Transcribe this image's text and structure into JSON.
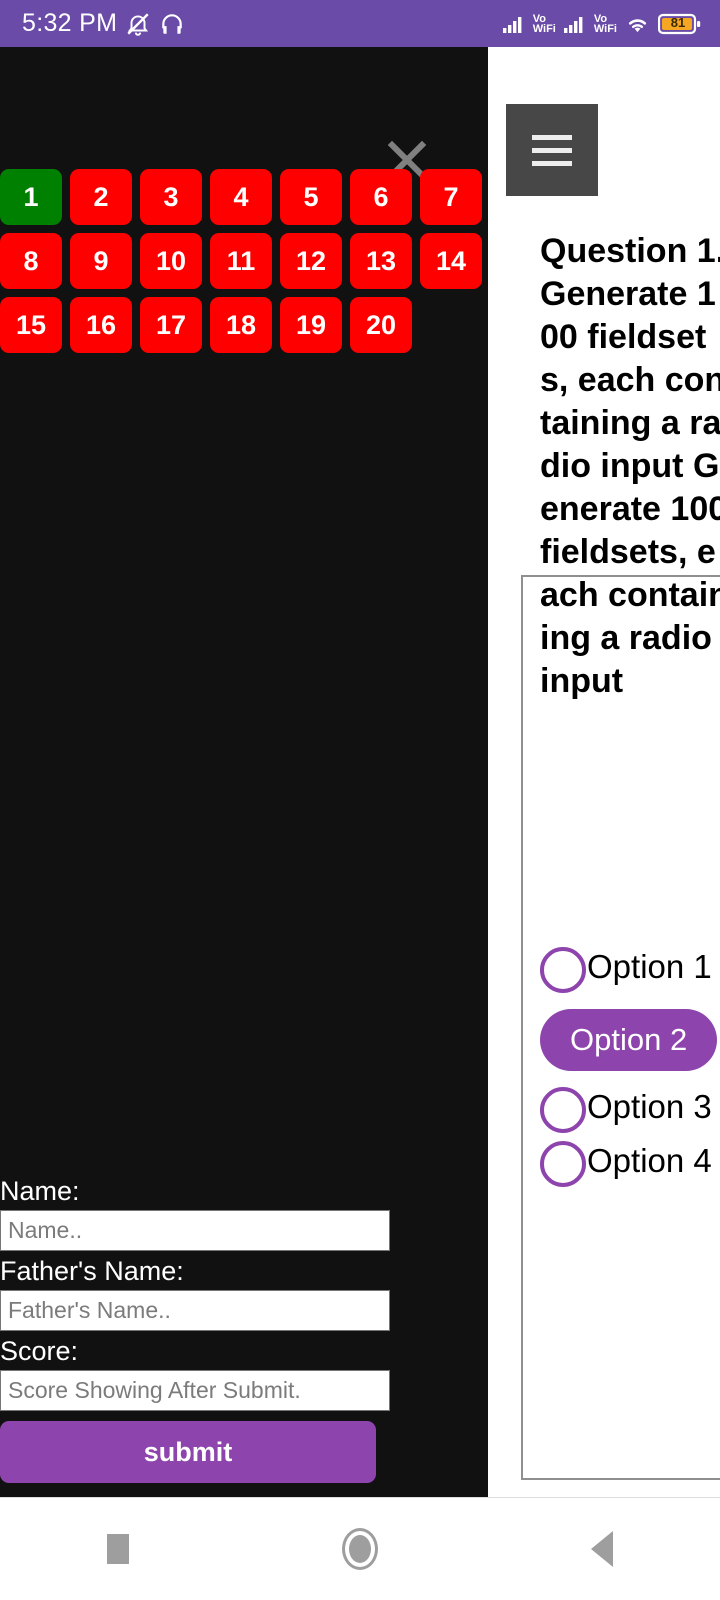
{
  "statusbar": {
    "time": "5:32 PM",
    "icons_left": [
      "bell-muted-icon",
      "headphones-icon"
    ],
    "network_label_1": "Vo",
    "network_sub_1": "WiFi",
    "network_label_2": "Vo",
    "network_sub_2": "WiFi",
    "wifi_icon": "wifi-icon",
    "battery_level": "81",
    "bg_color": "#6a4ba8"
  },
  "quiz_panel": {
    "close_icon": "close-icon",
    "numbers": [
      {
        "label": "1",
        "state": "answered"
      },
      {
        "label": "2",
        "state": "unanswered"
      },
      {
        "label": "3",
        "state": "unanswered"
      },
      {
        "label": "4",
        "state": "unanswered"
      },
      {
        "label": "5",
        "state": "unanswered"
      },
      {
        "label": "6",
        "state": "unanswered"
      },
      {
        "label": "7",
        "state": "unanswered"
      },
      {
        "label": "8",
        "state": "unanswered"
      },
      {
        "label": "9",
        "state": "unanswered"
      },
      {
        "label": "10",
        "state": "unanswered"
      },
      {
        "label": "11",
        "state": "unanswered"
      },
      {
        "label": "12",
        "state": "unanswered"
      },
      {
        "label": "13",
        "state": "unanswered"
      },
      {
        "label": "14",
        "state": "unanswered"
      },
      {
        "label": "15",
        "state": "unanswered"
      },
      {
        "label": "16",
        "state": "unanswered"
      },
      {
        "label": "17",
        "state": "unanswered"
      },
      {
        "label": "18",
        "state": "unanswered"
      },
      {
        "label": "19",
        "state": "unanswered"
      },
      {
        "label": "20",
        "state": "unanswered"
      }
    ],
    "colors": {
      "answered": "#008000",
      "unanswered": "#ff0000",
      "panel_bg": "#111111",
      "accent": "#8e44ad"
    },
    "form": {
      "name_label": "Name:",
      "name_placeholder": "Name..",
      "name_value": "",
      "father_label": "Father's Name:",
      "father_placeholder": "Father's Name..",
      "father_value": "",
      "score_label": "Score:",
      "score_placeholder": "Score Showing After Submit.",
      "score_value": "",
      "submit_label": "submit"
    }
  },
  "question_panel": {
    "menu_icon": "hamburger-menu-icon",
    "question_text": "Question 1. Generate 100 fieldsets, each containing a radio input Generate 100 fieldsets, each containing a radio input",
    "options": [
      {
        "label": "Option 1",
        "selected": false
      },
      {
        "label": "Option 2",
        "selected": true
      },
      {
        "label": "Option 3",
        "selected": false
      },
      {
        "label": "Option 4",
        "selected": false
      }
    ]
  },
  "navbar": {
    "recents": "recents-square-icon",
    "home": "home-circle-icon",
    "back": "back-triangle-icon"
  }
}
